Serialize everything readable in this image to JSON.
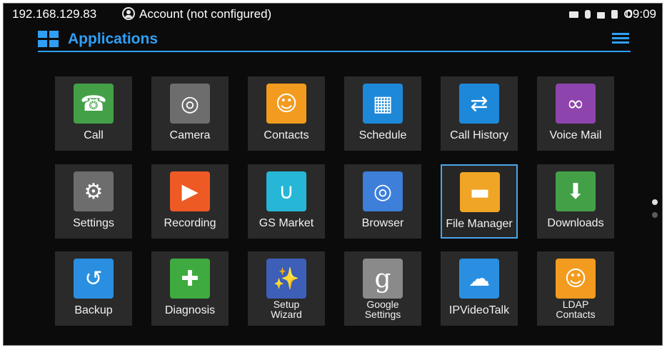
{
  "status_bar": {
    "ip": "192.168.129.83",
    "account": "Account (not configured)",
    "time": "09:09",
    "icons": [
      "monitor-icon",
      "usb-icon",
      "lock-icon",
      "sd-card-icon",
      "sync-icon"
    ]
  },
  "header": {
    "title": "Applications",
    "accent_color": "#2f9ff5"
  },
  "apps": [
    {
      "label": "Call",
      "icon": "call-icon",
      "color": "#43a047"
    },
    {
      "label": "Camera",
      "icon": "camera-icon",
      "color": "#6d6d6d"
    },
    {
      "label": "Contacts",
      "icon": "contacts-icon",
      "color": "#f29b1e"
    },
    {
      "label": "Schedule",
      "icon": "schedule-icon",
      "color": "#1e88d8"
    },
    {
      "label": "Call History",
      "icon": "call-history-icon",
      "color": "#1e88d8"
    },
    {
      "label": "Voice Mail",
      "icon": "voice-mail-icon",
      "color": "#8e44ad"
    },
    {
      "label": "Settings",
      "icon": "settings-icon",
      "color": "#6d6d6d"
    },
    {
      "label": "Recording",
      "icon": "recording-icon",
      "color": "#ee5a24"
    },
    {
      "label": "GS Market",
      "icon": "gs-market-icon",
      "color": "#26b6d6"
    },
    {
      "label": "Browser",
      "icon": "browser-icon",
      "color": "#3d7fd9"
    },
    {
      "label": "File Manager",
      "icon": "file-manager-icon",
      "color": "#f0a526",
      "selected": true
    },
    {
      "label": "Downloads",
      "icon": "downloads-icon",
      "color": "#43a047"
    },
    {
      "label": "Backup",
      "icon": "backup-icon",
      "color": "#2a8fe0"
    },
    {
      "label": "Diagnosis",
      "icon": "diagnosis-icon",
      "color": "#3faa3f"
    },
    {
      "label": "Setup\nWizard",
      "icon": "setup-wizard-icon",
      "color": "#3d5fb8"
    },
    {
      "label": "Google\nSettings",
      "icon": "google-settings-icon",
      "color": "#8a8a8a"
    },
    {
      "label": "IPVideoTalk",
      "icon": "ipvideotalk-icon",
      "color": "#2a8fe0"
    },
    {
      "label": "LDAP\nContacts",
      "icon": "ldap-contacts-icon",
      "color": "#f29b1e"
    }
  ],
  "pager": {
    "page_count": 2,
    "current_page": 1
  }
}
